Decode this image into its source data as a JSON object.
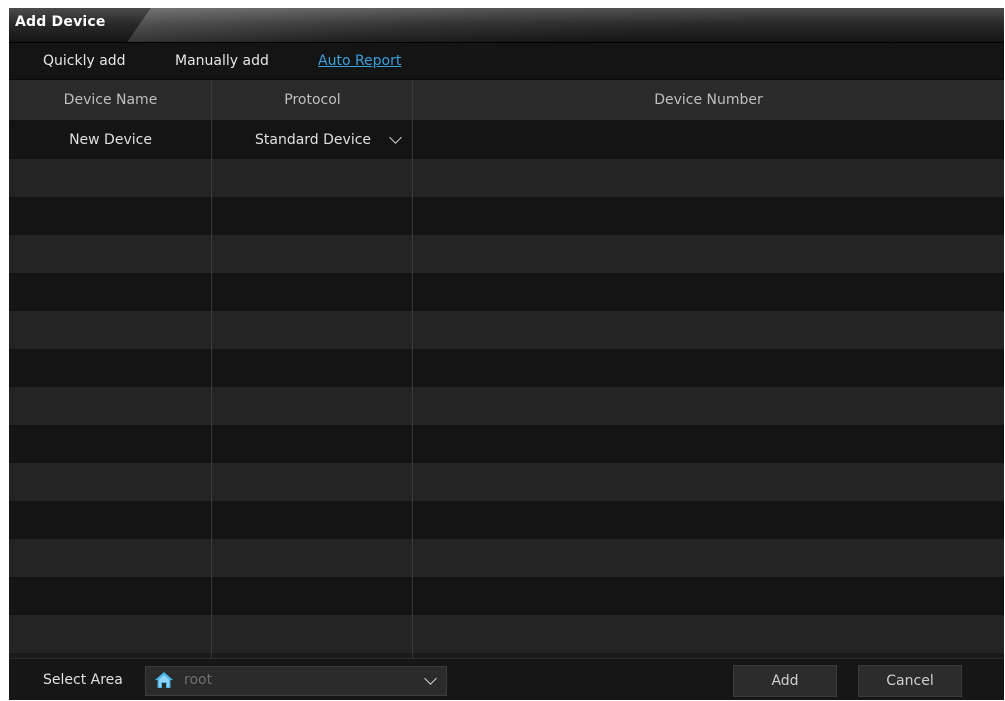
{
  "window": {
    "title": "Add Device"
  },
  "tabs": [
    {
      "label": "Quickly add",
      "active": false
    },
    {
      "label": "Manually add",
      "active": false
    },
    {
      "label": "Auto Report",
      "active": true
    }
  ],
  "table": {
    "columns": [
      "Device Name",
      "Protocol",
      "Device Number"
    ],
    "rows": [
      {
        "device_name": "New Device",
        "protocol": "Standard Device",
        "device_number": ""
      }
    ]
  },
  "footer": {
    "select_area_label": "Select Area",
    "area_value": "root",
    "add_label": "Add",
    "cancel_label": "Cancel"
  },
  "colors": {
    "accent": "#3aa0de",
    "background": "#1b1b1b",
    "header_bg": "#2a2a2a",
    "row_alt": "#242424",
    "row_base": "#141414"
  },
  "icons": {
    "area": "home-icon",
    "dropdown": "chevron-down-icon"
  }
}
